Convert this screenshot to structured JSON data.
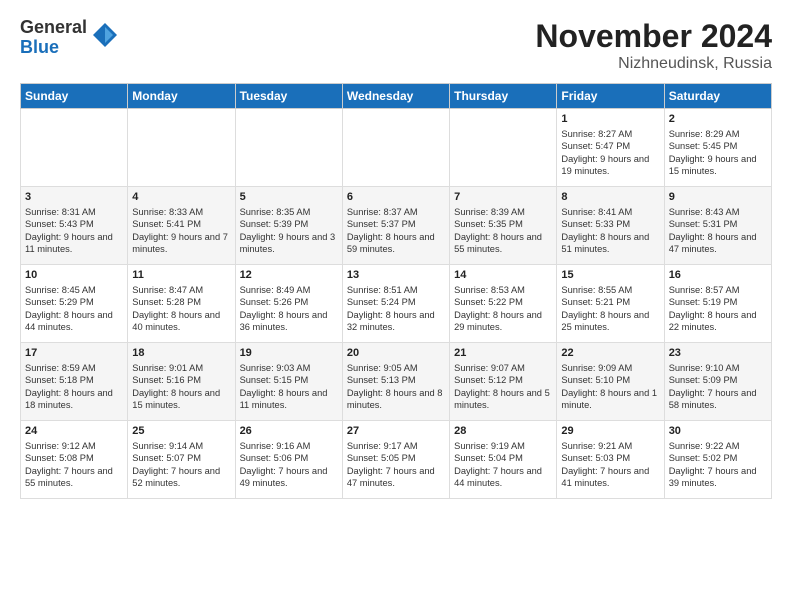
{
  "logo": {
    "general": "General",
    "blue": "Blue"
  },
  "title": "November 2024",
  "location": "Nizhneudinsk, Russia",
  "headers": [
    "Sunday",
    "Monday",
    "Tuesday",
    "Wednesday",
    "Thursday",
    "Friday",
    "Saturday"
  ],
  "weeks": [
    [
      {
        "day": "",
        "detail": ""
      },
      {
        "day": "",
        "detail": ""
      },
      {
        "day": "",
        "detail": ""
      },
      {
        "day": "",
        "detail": ""
      },
      {
        "day": "",
        "detail": ""
      },
      {
        "day": "1",
        "detail": "Sunrise: 8:27 AM\nSunset: 5:47 PM\nDaylight: 9 hours and 19 minutes."
      },
      {
        "day": "2",
        "detail": "Sunrise: 8:29 AM\nSunset: 5:45 PM\nDaylight: 9 hours and 15 minutes."
      }
    ],
    [
      {
        "day": "3",
        "detail": "Sunrise: 8:31 AM\nSunset: 5:43 PM\nDaylight: 9 hours and 11 minutes."
      },
      {
        "day": "4",
        "detail": "Sunrise: 8:33 AM\nSunset: 5:41 PM\nDaylight: 9 hours and 7 minutes."
      },
      {
        "day": "5",
        "detail": "Sunrise: 8:35 AM\nSunset: 5:39 PM\nDaylight: 9 hours and 3 minutes."
      },
      {
        "day": "6",
        "detail": "Sunrise: 8:37 AM\nSunset: 5:37 PM\nDaylight: 8 hours and 59 minutes."
      },
      {
        "day": "7",
        "detail": "Sunrise: 8:39 AM\nSunset: 5:35 PM\nDaylight: 8 hours and 55 minutes."
      },
      {
        "day": "8",
        "detail": "Sunrise: 8:41 AM\nSunset: 5:33 PM\nDaylight: 8 hours and 51 minutes."
      },
      {
        "day": "9",
        "detail": "Sunrise: 8:43 AM\nSunset: 5:31 PM\nDaylight: 8 hours and 47 minutes."
      }
    ],
    [
      {
        "day": "10",
        "detail": "Sunrise: 8:45 AM\nSunset: 5:29 PM\nDaylight: 8 hours and 44 minutes."
      },
      {
        "day": "11",
        "detail": "Sunrise: 8:47 AM\nSunset: 5:28 PM\nDaylight: 8 hours and 40 minutes."
      },
      {
        "day": "12",
        "detail": "Sunrise: 8:49 AM\nSunset: 5:26 PM\nDaylight: 8 hours and 36 minutes."
      },
      {
        "day": "13",
        "detail": "Sunrise: 8:51 AM\nSunset: 5:24 PM\nDaylight: 8 hours and 32 minutes."
      },
      {
        "day": "14",
        "detail": "Sunrise: 8:53 AM\nSunset: 5:22 PM\nDaylight: 8 hours and 29 minutes."
      },
      {
        "day": "15",
        "detail": "Sunrise: 8:55 AM\nSunset: 5:21 PM\nDaylight: 8 hours and 25 minutes."
      },
      {
        "day": "16",
        "detail": "Sunrise: 8:57 AM\nSunset: 5:19 PM\nDaylight: 8 hours and 22 minutes."
      }
    ],
    [
      {
        "day": "17",
        "detail": "Sunrise: 8:59 AM\nSunset: 5:18 PM\nDaylight: 8 hours and 18 minutes."
      },
      {
        "day": "18",
        "detail": "Sunrise: 9:01 AM\nSunset: 5:16 PM\nDaylight: 8 hours and 15 minutes."
      },
      {
        "day": "19",
        "detail": "Sunrise: 9:03 AM\nSunset: 5:15 PM\nDaylight: 8 hours and 11 minutes."
      },
      {
        "day": "20",
        "detail": "Sunrise: 9:05 AM\nSunset: 5:13 PM\nDaylight: 8 hours and 8 minutes."
      },
      {
        "day": "21",
        "detail": "Sunrise: 9:07 AM\nSunset: 5:12 PM\nDaylight: 8 hours and 5 minutes."
      },
      {
        "day": "22",
        "detail": "Sunrise: 9:09 AM\nSunset: 5:10 PM\nDaylight: 8 hours and 1 minute."
      },
      {
        "day": "23",
        "detail": "Sunrise: 9:10 AM\nSunset: 5:09 PM\nDaylight: 7 hours and 58 minutes."
      }
    ],
    [
      {
        "day": "24",
        "detail": "Sunrise: 9:12 AM\nSunset: 5:08 PM\nDaylight: 7 hours and 55 minutes."
      },
      {
        "day": "25",
        "detail": "Sunrise: 9:14 AM\nSunset: 5:07 PM\nDaylight: 7 hours and 52 minutes."
      },
      {
        "day": "26",
        "detail": "Sunrise: 9:16 AM\nSunset: 5:06 PM\nDaylight: 7 hours and 49 minutes."
      },
      {
        "day": "27",
        "detail": "Sunrise: 9:17 AM\nSunset: 5:05 PM\nDaylight: 7 hours and 47 minutes."
      },
      {
        "day": "28",
        "detail": "Sunrise: 9:19 AM\nSunset: 5:04 PM\nDaylight: 7 hours and 44 minutes."
      },
      {
        "day": "29",
        "detail": "Sunrise: 9:21 AM\nSunset: 5:03 PM\nDaylight: 7 hours and 41 minutes."
      },
      {
        "day": "30",
        "detail": "Sunrise: 9:22 AM\nSunset: 5:02 PM\nDaylight: 7 hours and 39 minutes."
      }
    ]
  ]
}
